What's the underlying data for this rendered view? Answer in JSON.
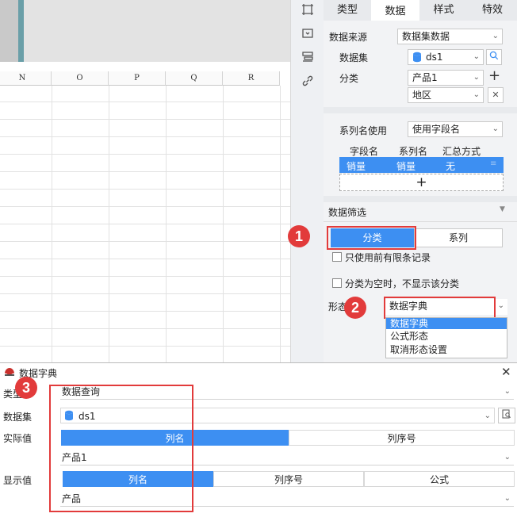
{
  "sheet": {
    "columns": [
      "N",
      "O",
      "P",
      "Q",
      "R"
    ]
  },
  "panel": {
    "tabs": [
      "类型",
      "数据",
      "样式",
      "特效"
    ],
    "active_tab": "数据",
    "data_source_label": "数据来源",
    "data_source_value": "数据集数据",
    "dataset_label": "数据集",
    "dataset_value": "ds1",
    "category_label": "分类",
    "category_values": [
      "产品1",
      "地区"
    ],
    "series_name_label": "系列名使用",
    "series_name_value": "使用字段名",
    "field_table": {
      "headers": [
        "字段名",
        "系列名",
        "汇总方式"
      ],
      "row": [
        "销量",
        "销量",
        "无"
      ]
    },
    "add_symbol": "+",
    "filter_title": "数据筛选",
    "filter_seg": [
      "分类",
      "系列"
    ],
    "check1": "只使用前有限条记录",
    "check2": "分类为空时，不显示该分类",
    "shape_label": "形态",
    "shape_value": "数据字典",
    "shape_options": [
      "数据字典",
      "公式形态",
      "取消形态设置"
    ]
  },
  "badges": [
    "1",
    "2",
    "3"
  ],
  "dialog": {
    "title": "数据字典",
    "type_label": "类型",
    "type_value": "数据查询",
    "dataset_label": "数据集",
    "dataset_value": "ds1",
    "actual_label": "实际值",
    "actual_seg": [
      "列名",
      "列序号"
    ],
    "actual_value": "产品1",
    "display_label": "显示值",
    "display_seg": [
      "列名",
      "列序号",
      "公式"
    ],
    "display_value": "产品"
  },
  "colors": {
    "accent": "#3d8ff2",
    "highlight": "#e23b3b"
  }
}
